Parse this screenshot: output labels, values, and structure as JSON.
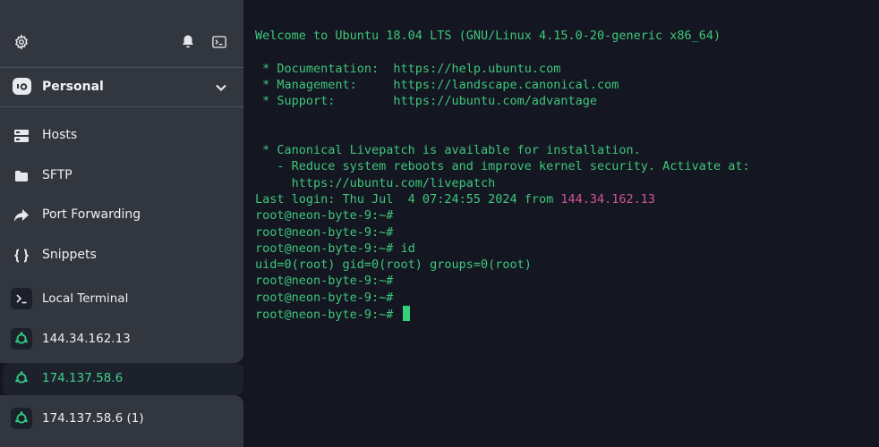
{
  "sidebar": {
    "toolbar": {
      "settings_icon": "gear-icon",
      "notifications_icon": "bell-icon",
      "terminal_icon": "terminal-icon"
    },
    "vault": {
      "label": "Personal",
      "icon": "vault-logo-icon"
    },
    "nav": [
      {
        "label": "Hosts",
        "icon": "server-icon"
      },
      {
        "label": "SFTP",
        "icon": "folder-icon"
      },
      {
        "label": "Port Forwarding",
        "icon": "forward-arrow-icon"
      },
      {
        "label": "Snippets",
        "icon": "braces-icon"
      }
    ],
    "local_terminal": {
      "label": "Local Terminal",
      "icon": "terminal-prompt-icon"
    },
    "hosts": [
      {
        "label": "144.34.162.13",
        "icon": "ubuntu-icon"
      },
      {
        "label": "174.137.58.6",
        "icon": "ubuntu-icon",
        "active": true
      },
      {
        "label": "174.137.58.6 (1)",
        "icon": "ubuntu-icon"
      }
    ]
  },
  "terminal": {
    "welcome": "Welcome to Ubuntu 18.04 LTS (GNU/Linux 4.15.0-20-generic x86_64)",
    "doc_line": " * Documentation:  https://help.ubuntu.com",
    "mgmt_line": " * Management:     https://landscape.canonical.com",
    "support_line": " * Support:        https://ubuntu.com/advantage",
    "livepatch_line": " * Canonical Livepatch is available for installation.",
    "reduce_line": "   - Reduce system reboots and improve kernel security. Activate at:",
    "livepatch_url": "     https://ubuntu.com/livepatch",
    "last_login_prefix": "Last login: Thu Jul  4 07:24:55 2024 from ",
    "last_login_ip": "144.34.162.13",
    "prompt": "root@neon-byte-9:~#",
    "cmd_id": " id",
    "id_output": "uid=0(root) gid=0(root) groups=0(root)"
  },
  "colors": {
    "sidebar_bg": "#31363f",
    "terminal_bg": "#141622",
    "terminal_text": "#3fc77a",
    "ip_highlight": "#d2559a",
    "active_host": "#3fd28a"
  }
}
